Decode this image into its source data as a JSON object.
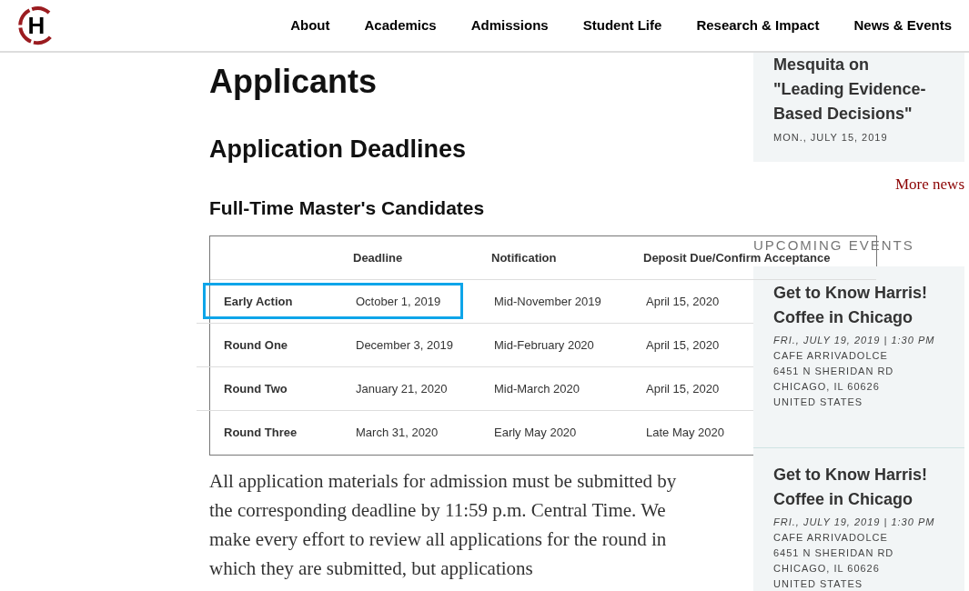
{
  "nav": {
    "logo_letter": "H",
    "items": [
      {
        "label": "About"
      },
      {
        "label": "Academics"
      },
      {
        "label": "Admissions"
      },
      {
        "label": "Student Life"
      },
      {
        "label": "Research & Impact"
      },
      {
        "label": "News & Events"
      }
    ]
  },
  "main": {
    "title": "Applicants",
    "section_title": "Application Deadlines",
    "subsection_title": "Full-Time Master's Candidates",
    "table": {
      "columns": [
        "Deadline",
        "Notification",
        "Deposit Due/Confirm Acceptance"
      ],
      "rows": [
        {
          "round": "Early Action",
          "deadline": "October 1, 2019",
          "notification": "Mid-November 2019",
          "deposit": "April 15, 2020",
          "highlighted": true
        },
        {
          "round": "Round One",
          "deadline": "December 3, 2019",
          "notification": "Mid-February 2020",
          "deposit": "April 15, 2020",
          "highlighted": false
        },
        {
          "round": "Round Two",
          "deadline": "January 21, 2020",
          "notification": "Mid-March 2020",
          "deposit": "April 15, 2020",
          "highlighted": false
        },
        {
          "round": "Round Three",
          "deadline": "March 31, 2020",
          "notification": "Early May 2020",
          "deposit": "Late May 2020",
          "highlighted": false
        }
      ]
    },
    "paragraph": "All application materials for admission must be submitted by the corresponding deadline by 11:59 p.m. Central Time. We make every effort to review all applications for the round in which they are submitted, but applications"
  },
  "sidebar": {
    "news": {
      "title": "Mesquita on \"Leading Evidence-Based Decisions\"",
      "date": "MON., JULY 15, 2019"
    },
    "more_news": "More news",
    "events_heading": "UPCOMING EVENTS",
    "events": [
      {
        "title": "Get to Know Harris! Coffee in Chicago",
        "when": "FRI., JULY 19, 2019 | 1:30 PM",
        "address": [
          "CAFE ARRIVADOLCE",
          "6451 N SHERIDAN RD",
          "CHICAGO, IL 60626",
          "UNITED STATES"
        ]
      },
      {
        "title": "Get to Know Harris! Coffee in Chicago",
        "when": "FRI., JULY 19, 2019 | 1:30 PM",
        "address": [
          "CAFE ARRIVADOLCE",
          "6451 N SHERIDAN RD",
          "CHICAGO, IL 60626",
          "UNITED STATES"
        ]
      }
    ]
  }
}
